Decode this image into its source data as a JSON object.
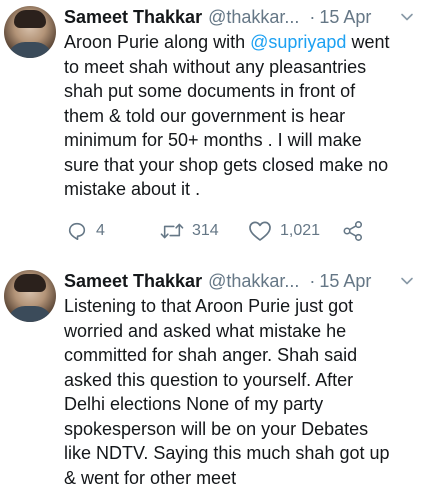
{
  "tweets": [
    {
      "name": "Sameet Thakkar",
      "handle": "@thakkar...",
      "separator": "·",
      "date": "15 Apr",
      "text_before_mention": "Aroon Purie along with ",
      "mention": "@supriyapd",
      "text_after_mention": " went",
      "lines": [
        "to meet shah without any pleasantries",
        "shah put some documents in front of",
        "them & told our government  is hear",
        "minimum for 50+ months . I will make",
        "sure that your shop gets closed make no",
        "mistake about it ."
      ],
      "replies": "4",
      "retweets": "314",
      "likes": "1,021"
    },
    {
      "name": "Sameet Thakkar",
      "handle": "@thakkar...",
      "separator": "·",
      "date": "15 Apr",
      "lines": [
        "Listening to that Aroon Purie just got",
        "worried and asked what mistake he",
        "committed for shah anger. Shah said",
        "asked this question to yourself.  After",
        "Delhi elections None of my party",
        "spokesperson will be on your Debates",
        "like NDTV. Saying this much shah got up",
        "& went for other meet"
      ]
    }
  ],
  "icons": {
    "reply": "reply-icon",
    "retweet": "retweet-icon",
    "like": "like-icon",
    "share": "share-icon",
    "menu": "chevron-down-icon"
  },
  "colors": {
    "text": "#14171a",
    "muted": "#657786",
    "link": "#1da1f2"
  }
}
